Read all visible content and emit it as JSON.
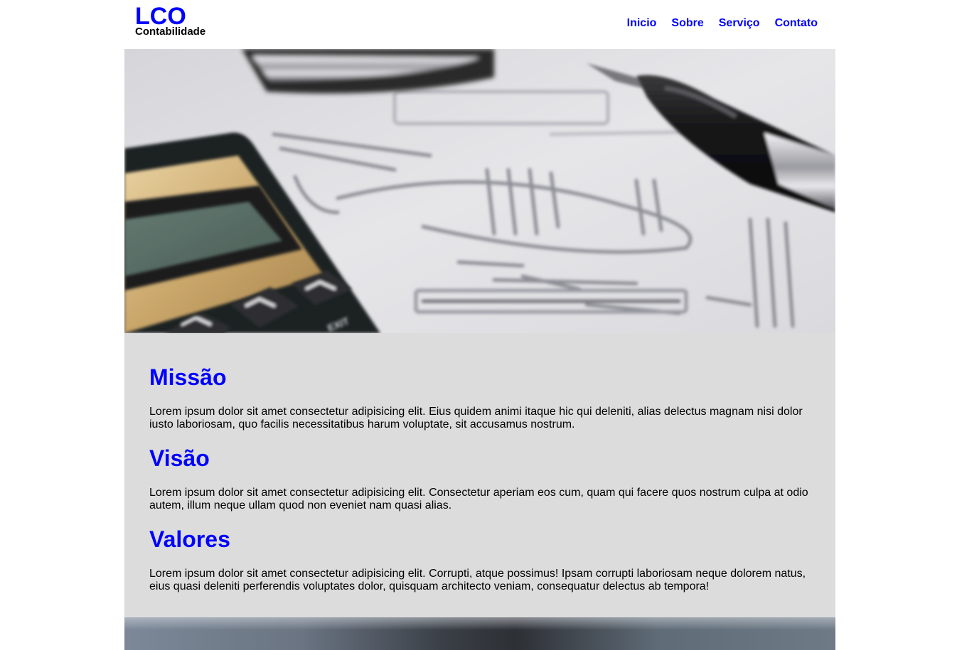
{
  "header": {
    "logo_title": "LCO",
    "logo_subtitle": "Contabilidade",
    "nav": [
      {
        "label": "Inicio"
      },
      {
        "label": "Sobre"
      },
      {
        "label": "Serviço"
      },
      {
        "label": "Contato"
      }
    ]
  },
  "hero": {
    "image_subject": "calculator-and-pen-on-accounting-papers",
    "calculator_key_label": "EXIT"
  },
  "sections": [
    {
      "title": "Missão",
      "text": "Lorem ipsum dolor sit amet consectetur adipisicing elit. Eius quidem animi itaque hic qui deleniti, alias delectus magnam nisi dolor iusto laboriosam, quo facilis necessitatibus harum voluptate, sit accusamus nostrum."
    },
    {
      "title": "Visão",
      "text": "Lorem ipsum dolor sit amet consectetur adipisicing elit. Consectetur aperiam eos cum, quam qui facere quos nostrum culpa at odio autem, illum neque ullam quod non eveniet nam quasi alias."
    },
    {
      "title": "Valores",
      "text": "Lorem ipsum dolor sit amet consectetur adipisicing elit. Corrupti, atque possimus! Ipsam corrupti laboriosam neque dolorem natus, eius quasi deleniti perferendis voluptates dolor, quisquam architecto veniam, consequatur delectus ab tempora!"
    }
  ],
  "colors": {
    "accent": "#0000ff",
    "content_background": "#dcdcdd",
    "text": "#000000"
  }
}
